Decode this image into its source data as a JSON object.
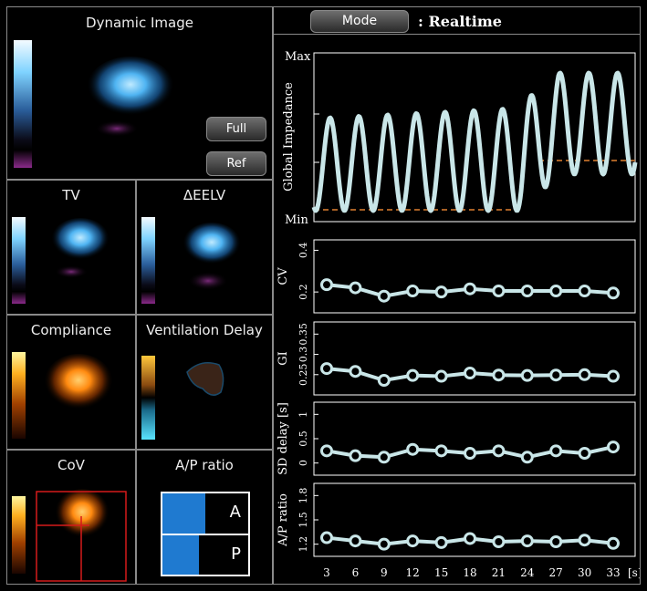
{
  "left": {
    "dynamic_image": {
      "title": "Dynamic Image",
      "full_label": "Full",
      "ref_label": "Ref"
    },
    "tv": {
      "title": "TV"
    },
    "deelv": {
      "title": "ΔEELV"
    },
    "compliance": {
      "title": "Compliance"
    },
    "ventilation_delay": {
      "title": "Ventilation Delay"
    },
    "cov": {
      "title": "CoV"
    },
    "ap_ratio": {
      "title": "A/P ratio",
      "a_label": "A",
      "p_label": "P",
      "a_fraction": 0.5,
      "p_fraction": 0.43
    }
  },
  "header": {
    "mode_label": "Mode",
    "status_text": ": Realtime"
  },
  "colors": {
    "trace": "#c9e6e8",
    "baseline": "#e08030",
    "bar": "#1f7ad0",
    "frame": "#8a8a8a"
  },
  "plots": {
    "impedance": {
      "ylabel": "Global Impedance",
      "ymax_label": "Max",
      "ymin_label": "Min"
    },
    "cv": {
      "ylabel": "CV",
      "ticks": [
        "0.2",
        "0.4"
      ],
      "ylim": [
        0.1,
        0.45
      ],
      "values": [
        0.235,
        0.22,
        0.18,
        0.205,
        0.2,
        0.215,
        0.205,
        0.205,
        0.205,
        0.205,
        0.195
      ]
    },
    "gi": {
      "ylabel": "GI",
      "ticks": [
        "0.25",
        "0.3",
        "0.35"
      ],
      "ylim": [
        0.2,
        0.38
      ],
      "values": [
        0.265,
        0.258,
        0.236,
        0.248,
        0.246,
        0.254,
        0.249,
        0.248,
        0.249,
        0.25,
        0.246
      ]
    },
    "sd_delay": {
      "ylabel": "SD delay [s]",
      "ticks": [
        "0",
        "0.5",
        "1"
      ],
      "ylim": [
        -0.25,
        1.25
      ],
      "values": [
        0.25,
        0.15,
        0.12,
        0.28,
        0.25,
        0.2,
        0.25,
        0.12,
        0.25,
        0.2,
        0.33
      ]
    },
    "ap_ratio": {
      "ylabel": "A/P ratio",
      "ticks": [
        "1.2",
        "1.5",
        "1.8"
      ],
      "ylim": [
        1.05,
        1.95
      ],
      "values": [
        1.28,
        1.24,
        1.2,
        1.24,
        1.22,
        1.27,
        1.23,
        1.24,
        1.23,
        1.25,
        1.21
      ]
    }
  },
  "x_axis": {
    "ticks": [
      "3",
      "6",
      "9",
      "12",
      "15",
      "18",
      "21",
      "24",
      "27",
      "30",
      "33"
    ],
    "unit": "[s]"
  }
}
